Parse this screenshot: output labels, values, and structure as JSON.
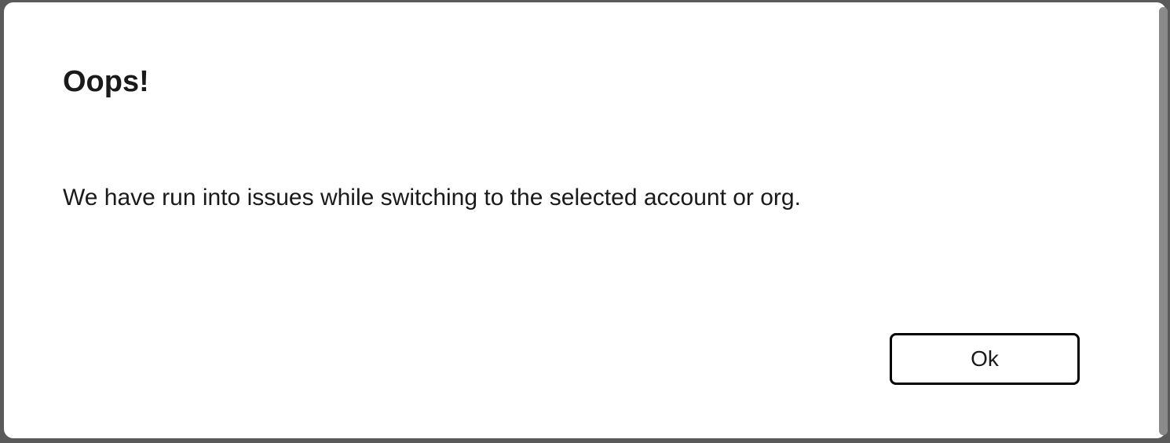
{
  "dialog": {
    "title": "Oops!",
    "message": "We have run into issues while switching to the selected account or org.",
    "ok_label": "Ok"
  }
}
